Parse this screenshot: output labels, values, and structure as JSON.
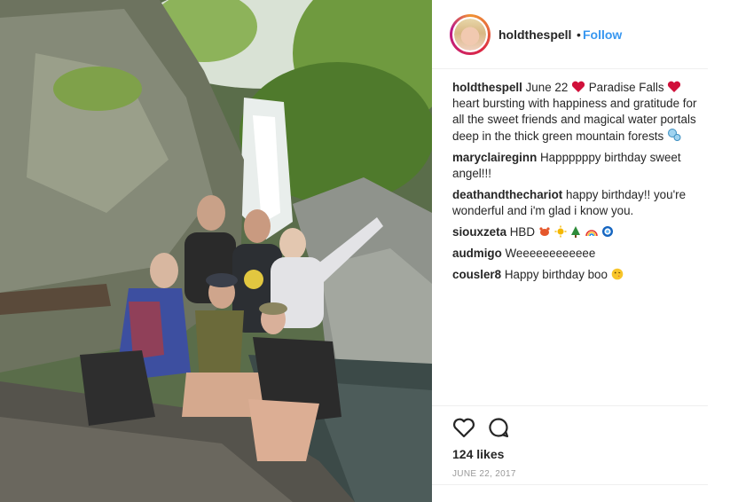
{
  "header": {
    "username": "holdthespell",
    "separator": "•",
    "follow_label": "Follow"
  },
  "caption": {
    "username": "holdthespell",
    "text_a": "June 22",
    "text_b": "Paradise Falls",
    "text_c": "heart bursting with happiness and gratitude for all the sweet friends and magical water portals deep in the thick green mountain forests"
  },
  "comments": [
    {
      "username": "maryclaireginn",
      "text": "Happppppy birthday sweet angel!!!"
    },
    {
      "username": "deathandthechariot",
      "text": "happy birthday!! you're wonderful and i'm glad i know you."
    },
    {
      "username": "siouxzeta",
      "text": "HBD"
    },
    {
      "username": "audmigo",
      "text": "Weeeeeeeeeeee"
    },
    {
      "username": "cousler8",
      "text": "Happy birthday boo"
    }
  ],
  "likes": "124 likes",
  "date": "JUNE 22, 2017",
  "icons": {
    "heart": "heart-icon",
    "comment": "comment-icon",
    "caption_emoji": "red-heart-emoji",
    "bubbles_emoji": "bubbles-emoji"
  },
  "colors": {
    "follow": "#3897f0",
    "text": "#262626",
    "muted": "#999999",
    "divider": "#efefef"
  }
}
